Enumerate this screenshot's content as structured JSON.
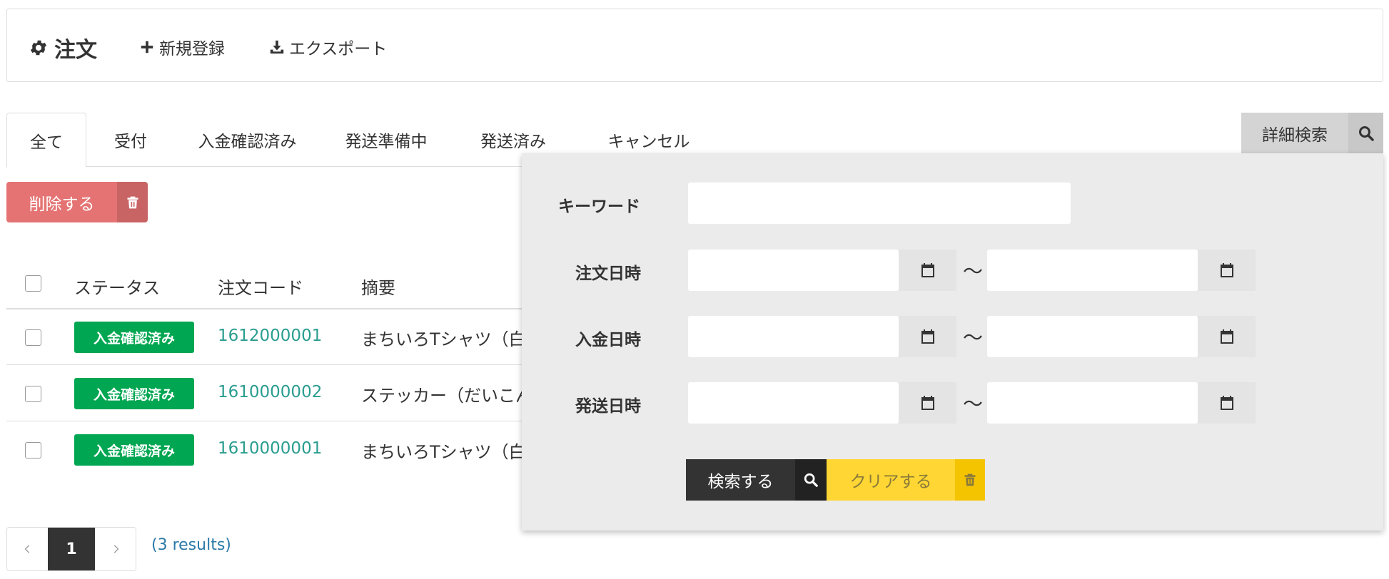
{
  "header": {
    "title": "注文",
    "title_icon": "gear-icon",
    "new_label": "新規登録",
    "export_label": "エクスポート"
  },
  "tabs": [
    {
      "label": "全て",
      "active": true
    },
    {
      "label": "受付",
      "active": false
    },
    {
      "label": "入金確認済み",
      "active": false
    },
    {
      "label": "発送準備中",
      "active": false
    },
    {
      "label": "発送済み",
      "active": false
    },
    {
      "label": "キャンセル",
      "active": false
    }
  ],
  "detail_search": {
    "label": "詳細検索"
  },
  "toolbar": {
    "delete_label": "削除する"
  },
  "table": {
    "columns": [
      "ステータス",
      "注文コード",
      "摘要"
    ],
    "rows": [
      {
        "status": "入金確認済み",
        "code": "1612000001",
        "summary": "まちいろTシャツ（白"
      },
      {
        "status": "入金確認済み",
        "code": "1610000002",
        "summary": "ステッカー（だいこん"
      },
      {
        "status": "入金確認済み",
        "code": "1610000001",
        "summary": "まちいろTシャツ（白"
      }
    ]
  },
  "pagination": {
    "current": "1",
    "results": "(3 results)"
  },
  "search_panel": {
    "keyword_label": "キーワード",
    "keyword_value": "",
    "order_date_label": "注文日時",
    "payment_date_label": "入金日時",
    "shipping_date_label": "発送日時",
    "range_separator": "〜",
    "search_label": "検索する",
    "clear_label": "クリアする"
  },
  "colors": {
    "status_green": "#00a651",
    "delete_red": "#e57373",
    "clear_yellow": "#ffd633",
    "link_teal": "#2a9d8f",
    "dark": "#333333"
  }
}
